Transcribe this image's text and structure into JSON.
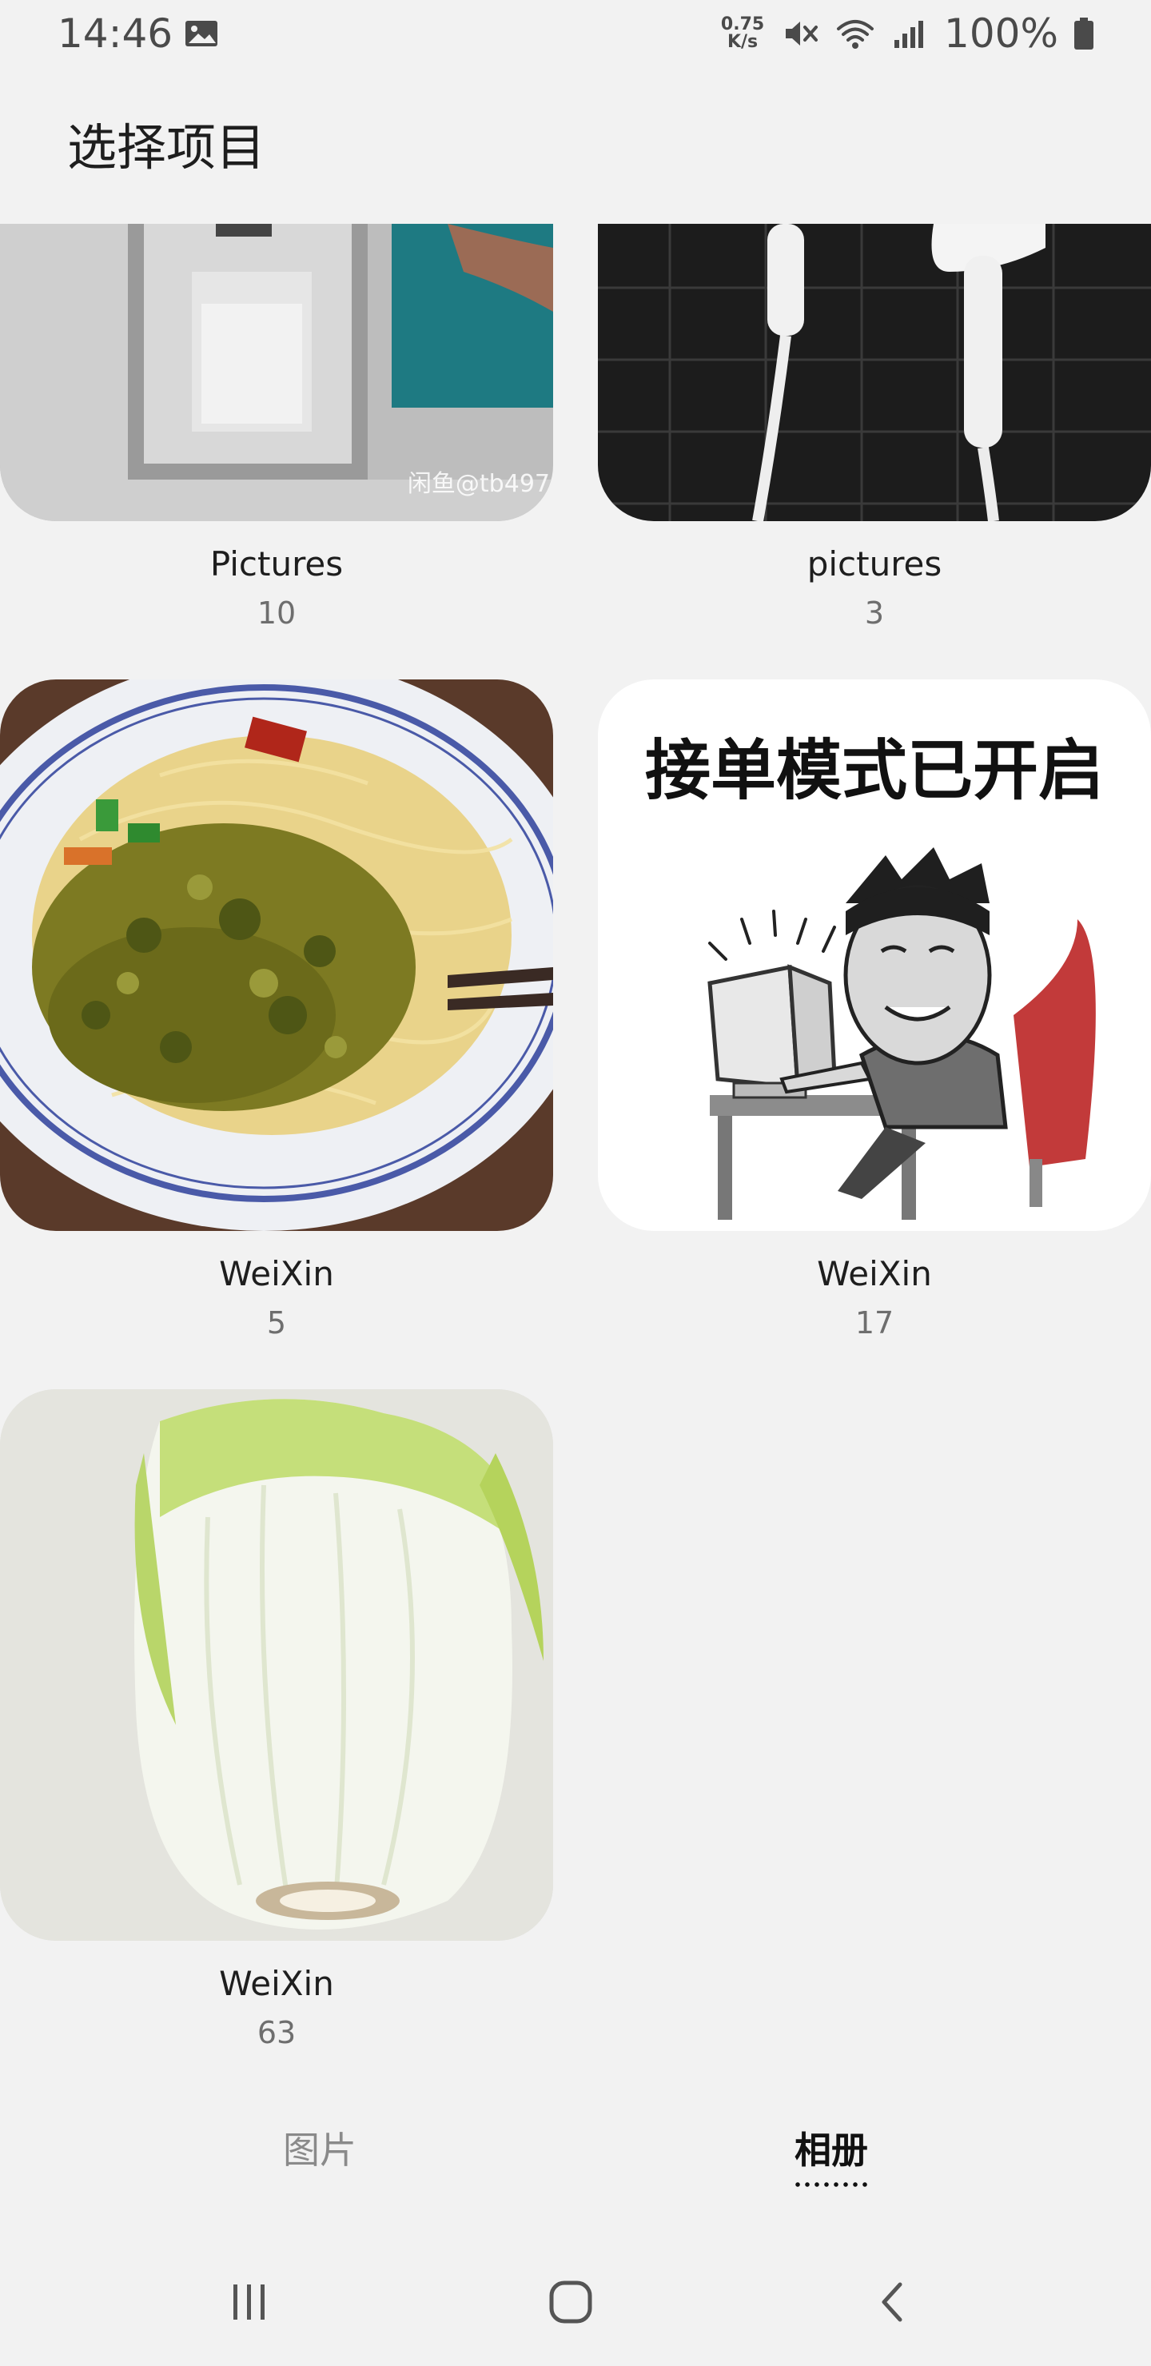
{
  "status": {
    "time": "14:46",
    "net_speed_value": "0.75",
    "net_speed_unit": "K/s",
    "battery": "100%",
    "icons": [
      "gallery-icon",
      "mute-icon",
      "wifi-icon",
      "signal-icon",
      "battery-icon"
    ]
  },
  "header": {
    "title": "选择项目"
  },
  "albums": [
    {
      "name": "Pictures",
      "count": "10",
      "watermark": "闲鱼@tb497"
    },
    {
      "name": "pictures",
      "count": "3"
    },
    {
      "name": "WeiXin",
      "count": "5"
    },
    {
      "name": "WeiXin",
      "count": "17",
      "meme_caption": "接单模式已开启"
    },
    {
      "name": "WeiXin",
      "count": "63"
    }
  ],
  "tabs": {
    "pictures": "图片",
    "albums": "相册",
    "active": "albums"
  },
  "colors": {
    "background": "#f2f2f2",
    "tab_active": "#111111",
    "tab_inactive": "#8a8a8a"
  }
}
